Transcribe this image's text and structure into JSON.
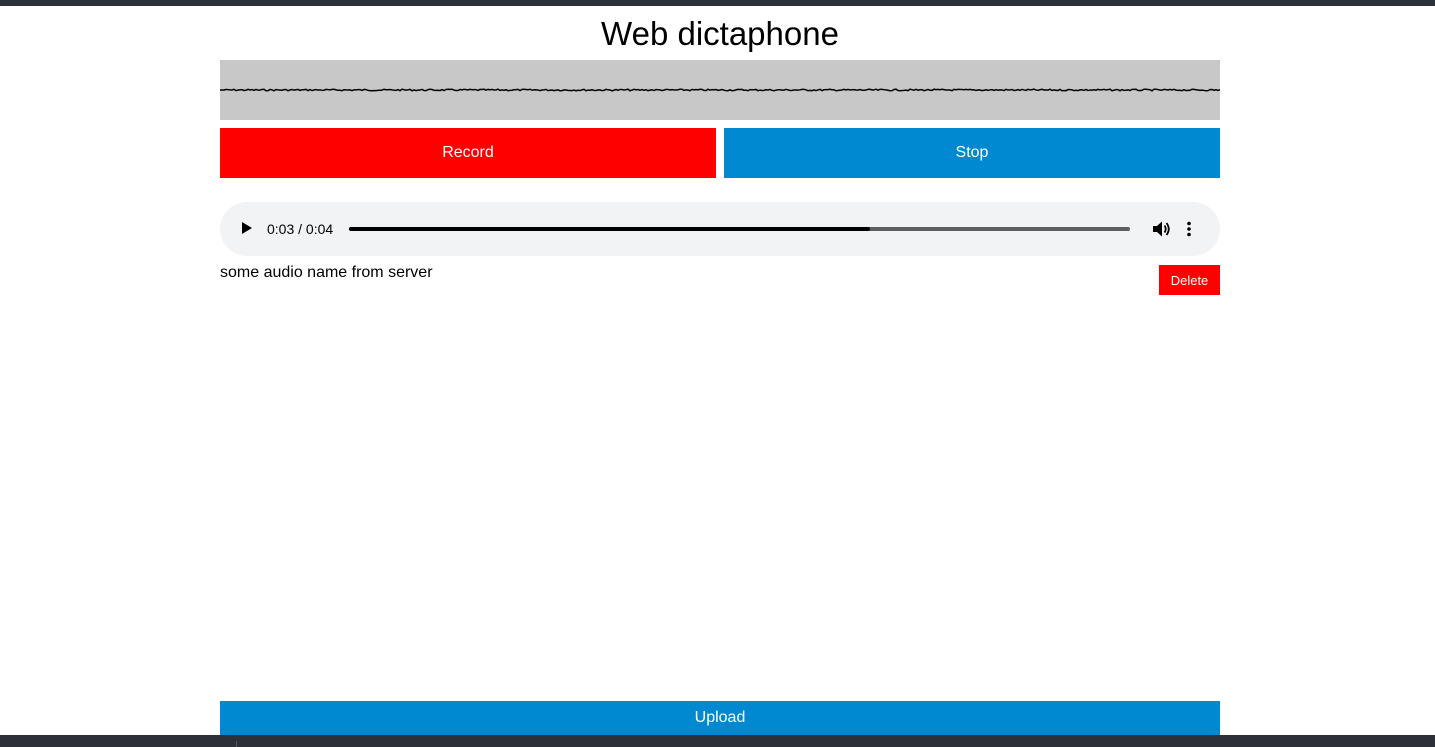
{
  "app": {
    "title": "Web dictaphone"
  },
  "controls": {
    "record_label": "Record",
    "stop_label": "Stop",
    "upload_label": "Upload"
  },
  "player": {
    "time": "0:03 / 0:04",
    "progress": 0.667,
    "play_icon": "play-icon",
    "volume_icon": "volume-icon",
    "more_icon": "more-vertical-icon"
  },
  "clip": {
    "name": "some audio name from server",
    "delete_label": "Delete"
  },
  "colors": {
    "record": "#ff0000",
    "stop": "#0088d0",
    "upload": "#0088d0",
    "delete": "#ff0000",
    "waveform_bg": "#c8c8c8",
    "player_bg": "#f1f3f4",
    "frame": "#2d3038"
  }
}
